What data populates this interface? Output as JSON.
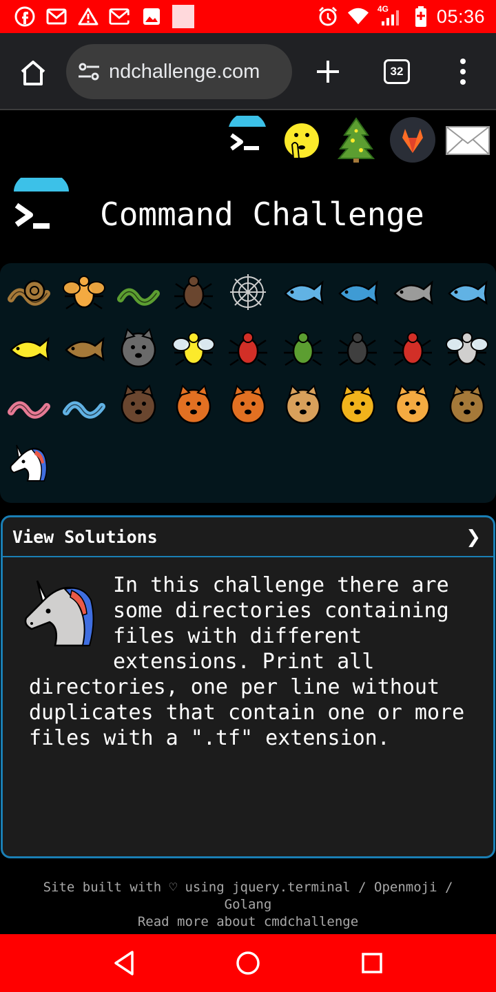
{
  "status_bar": {
    "time": "05:36",
    "network": "4G",
    "colors": {
      "background": "#ff0000"
    },
    "icons": [
      "facebook-icon",
      "gmail-icon",
      "warning-icon",
      "gmail-icon",
      "image-icon",
      "blank-notification-icon",
      "alarm-icon",
      "wifi-icon",
      "signal-icon",
      "battery-charging-icon"
    ]
  },
  "browser": {
    "url": "ndchallenge.com",
    "tab_count": "32"
  },
  "header_icons": [
    "terminal-logo-icon",
    "shushing-face-icon",
    "christmas-tree-icon",
    "gitlab-icon",
    "envelope-icon"
  ],
  "site": {
    "title": "Command Challenge"
  },
  "animals": [
    "snail",
    "butterfly",
    "caterpillar",
    "ant",
    "spider-web",
    "whale",
    "spouting-whale",
    "dolphin",
    "fish",
    "tropical-fish",
    "pufferfish",
    "wolf",
    "bee",
    "ladybug",
    "cricket",
    "spider",
    "scorpion",
    "fly",
    "worm",
    "microbe",
    "monkey-face",
    "dog-face",
    "fox-face",
    "cat-face",
    "lion-face",
    "tiger-face",
    "horse-face",
    "unicorn-face"
  ],
  "solutions": {
    "title": "View Solutions",
    "chevron": "❯",
    "text": "In this challenge there are some directories containing files with different extensions. Print all directories, one per line without duplicates that contain one or more files with a \".tf\" extension."
  },
  "footer": {
    "line1": "Site built with ♡ using jquery.terminal / Openmoji / Golang",
    "line2": "Read more about cmdchallenge"
  },
  "nav": {
    "colors": {
      "background": "#ff0000"
    },
    "buttons": [
      "back-triangle-icon",
      "home-circle-icon",
      "recents-square-icon"
    ]
  }
}
